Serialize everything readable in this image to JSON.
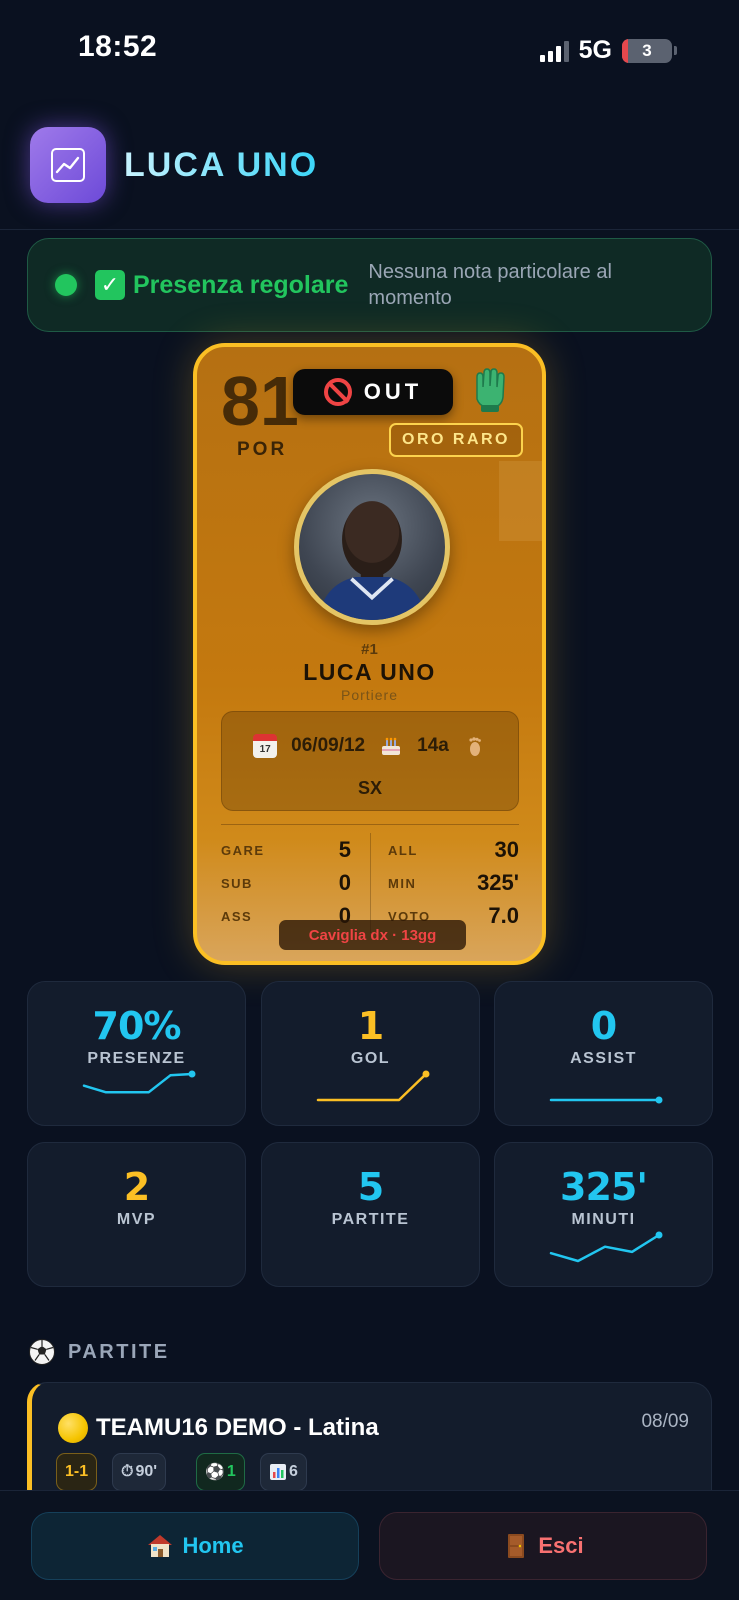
{
  "status_bar": {
    "time": "18:52",
    "network": "5G",
    "battery": "3"
  },
  "header": {
    "title": "LUCA UNO",
    "icon": "chart-line-icon"
  },
  "presence": {
    "label": "Presenza regolare",
    "note": "Nessuna nota particolare al momento",
    "color": "#22c55e"
  },
  "card": {
    "rating": "81",
    "position": "POR",
    "status": "OUT",
    "rarity": "ORO RARO",
    "number": "#1",
    "name": "LUCA UNO",
    "role": "Portiere",
    "birth_date": "06/09/12",
    "age": "14a",
    "foot": "SX",
    "stats": {
      "gare_label": "GARE",
      "gare": "5",
      "sub_label": "SUB",
      "sub": "0",
      "ass_label": "ASS",
      "ass": "0",
      "all_label": "ALL",
      "all": "30",
      "min_label": "MIN",
      "min": "325'",
      "voto_label": "VOTO",
      "voto": "7.0"
    },
    "injury": "Caviglia dx · 13gg",
    "accent": "#fbbf24"
  },
  "tiles": [
    {
      "value": "70%",
      "label": "PRESENZE",
      "trend": [
        0.55,
        0.3,
        0.3,
        0.3,
        0.95,
        1.0
      ]
    },
    {
      "value": "1",
      "label": "GOL",
      "trend": [
        0,
        0,
        0,
        0,
        1
      ]
    },
    {
      "value": "0",
      "label": "ASSIST",
      "trend": [
        0,
        0,
        0,
        0,
        0
      ]
    },
    {
      "value": "2",
      "label": "MVP"
    },
    {
      "value": "5",
      "label": "PARTITE"
    },
    {
      "value": "325'",
      "label": "MINUTI",
      "trend": [
        0.3,
        0,
        0.55,
        0.35,
        1.0
      ]
    }
  ],
  "matches": {
    "section_title": "PARTITE",
    "items": [
      {
        "title": "TEAMU16 DEMO - Latina",
        "date": "08/09",
        "score": "1-1",
        "minutes": "90'",
        "goals": "1",
        "rating": "6"
      }
    ]
  },
  "nav": {
    "home": "Home",
    "exit": "Esci"
  }
}
